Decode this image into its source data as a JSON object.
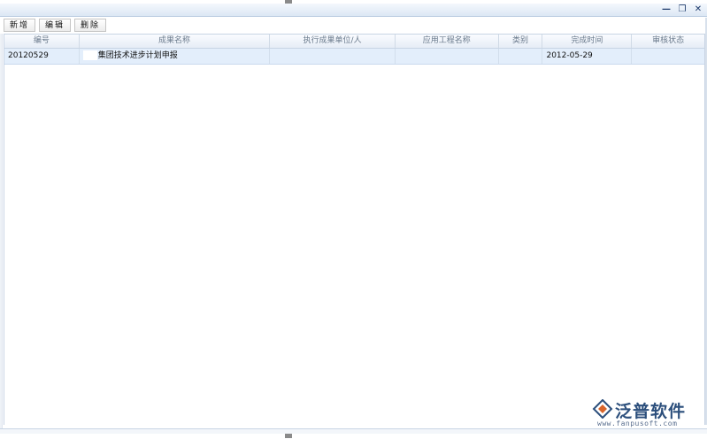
{
  "toolbar": {
    "add_label": "新增",
    "edit_label": "编辑",
    "delete_label": "删除"
  },
  "window_controls": {
    "minimize": "—",
    "restore": "❐",
    "close": "✕"
  },
  "grid": {
    "columns": [
      "编号",
      "成果名称",
      "执行成果单位/人",
      "应用工程名称",
      "类别",
      "完成时间",
      "审核状态"
    ],
    "rows": [
      {
        "code": "20120529",
        "name": "集团技术进步计划申报",
        "unit": "",
        "project": "",
        "category": "",
        "date": "2012-05-29",
        "status": ""
      }
    ]
  },
  "watermark": {
    "brand": "泛普软件",
    "url": "www.fanpusoft.com",
    "icon": "fanpu-logo-icon",
    "color": "#2c4f7c"
  }
}
